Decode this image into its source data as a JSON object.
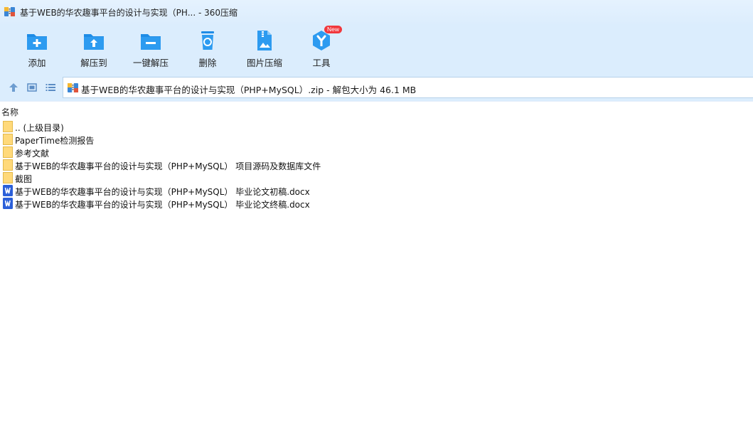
{
  "window": {
    "title": "基于WEB的华农趣事平台的设计与实现（PH... - 360压缩"
  },
  "toolbar": {
    "items": [
      {
        "label": "添加",
        "icon": "add-folder-icon"
      },
      {
        "label": "解压到",
        "icon": "extract-to-icon"
      },
      {
        "label": "一键解压",
        "icon": "one-click-extract-icon"
      },
      {
        "label": "删除",
        "icon": "recycle-bin-icon"
      },
      {
        "label": "图片压缩",
        "icon": "image-compress-icon"
      },
      {
        "label": "工具",
        "icon": "tools-icon",
        "badge": "New"
      }
    ]
  },
  "address": {
    "text": "基于WEB的华农趣事平台的设计与实现（PHP+MySQL）.zip - 解包大小为 46.1 MB"
  },
  "list": {
    "column_name": "名称",
    "rows": [
      {
        "name": ".. (上级目录)",
        "type": "folder"
      },
      {
        "name": "PaperTime检测报告",
        "type": "folder"
      },
      {
        "name": "参考文献",
        "type": "folder"
      },
      {
        "name": "基于WEB的华农趣事平台的设计与实现（PHP+MySQL） 项目源码及数据库文件",
        "type": "folder"
      },
      {
        "name": "截图",
        "type": "folder"
      },
      {
        "name": "基于WEB的华农趣事平台的设计与实现（PHP+MySQL） 毕业论文初稿.docx",
        "type": "docx"
      },
      {
        "name": "基于WEB的华农趣事平台的设计与实现（PHP+MySQL） 毕业论文终稿.docx",
        "type": "docx"
      }
    ]
  },
  "colors": {
    "toolbar_bg": "#dbedfd",
    "icon_blue": "#1e8ce6",
    "folder_yellow": "#ffd97a",
    "word_blue": "#2b5fd9",
    "badge_red": "#f1383d"
  }
}
